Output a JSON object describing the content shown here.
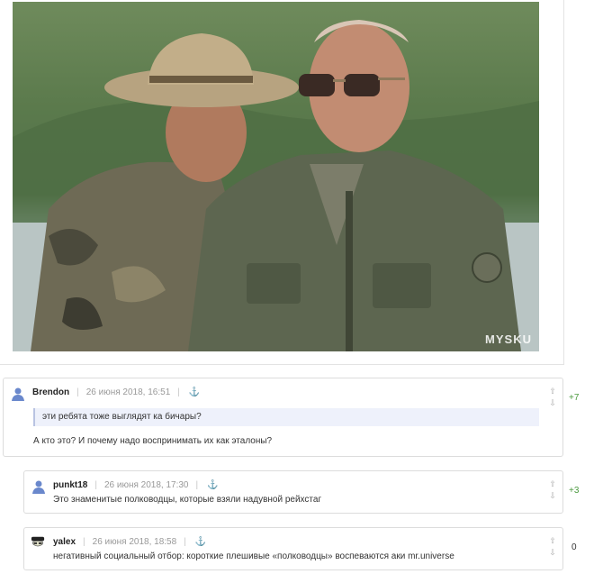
{
  "photo": {
    "watermark": "MYSKU"
  },
  "comments": [
    {
      "author": "Brendon",
      "date": "26 июня 2018, 16:51",
      "quote": "эти ребята тоже выглядят ка бичары?",
      "text": "А кто это? И почему надо воспринимать их как эталоны?",
      "rating": "+7",
      "avatar_icon": "user-avatar-icon"
    },
    {
      "author": "punkt18",
      "date": "26 июня 2018, 17:30",
      "text": "Это знаменитые полководцы, которые взяли надувной рейхстаг",
      "rating": "+3",
      "avatar_icon": "user-avatar-icon"
    },
    {
      "author": "yalex",
      "date": "26 июня 2018, 18:58",
      "text": "негативный социальный отбор: короткие плешивые «полководцы» воспеваются аки mr.universe",
      "rating": "0",
      "avatar_icon": "custom-avatar-icon"
    }
  ],
  "icons": {
    "anchor": "⚓",
    "up": "⇧",
    "down": "⇩"
  },
  "colors": {
    "positive": "#4b9a3f",
    "quote_bg": "#eef1fb"
  }
}
